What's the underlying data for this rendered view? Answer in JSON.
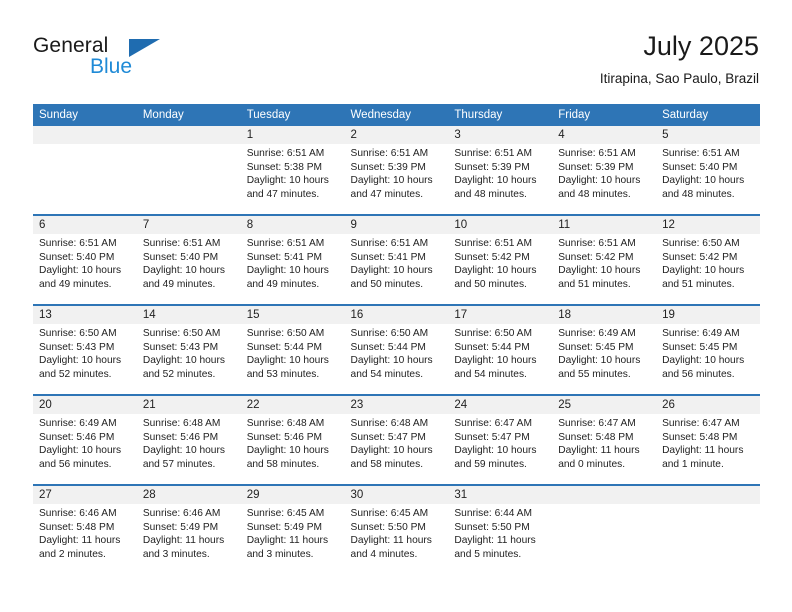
{
  "logo": {
    "word_one": "General",
    "word_two": "Blue",
    "triangle_icon": "triangle-icon",
    "accent_dark": "#1f6cb0",
    "accent_light": "#1f8ad6"
  },
  "header": {
    "title": "July 2025",
    "subtitle": "Itirapina, Sao Paulo, Brazil",
    "header_bg": "#2e75b6",
    "daynum_bg": "#f1f1f1"
  },
  "weekdays": [
    "Sunday",
    "Monday",
    "Tuesday",
    "Wednesday",
    "Thursday",
    "Friday",
    "Saturday"
  ],
  "weeks": [
    [
      {
        "day": "",
        "lines": []
      },
      {
        "day": "",
        "lines": []
      },
      {
        "day": "1",
        "lines": [
          "Sunrise: 6:51 AM",
          "Sunset: 5:38 PM",
          "Daylight: 10 hours",
          "and 47 minutes."
        ]
      },
      {
        "day": "2",
        "lines": [
          "Sunrise: 6:51 AM",
          "Sunset: 5:39 PM",
          "Daylight: 10 hours",
          "and 47 minutes."
        ]
      },
      {
        "day": "3",
        "lines": [
          "Sunrise: 6:51 AM",
          "Sunset: 5:39 PM",
          "Daylight: 10 hours",
          "and 48 minutes."
        ]
      },
      {
        "day": "4",
        "lines": [
          "Sunrise: 6:51 AM",
          "Sunset: 5:39 PM",
          "Daylight: 10 hours",
          "and 48 minutes."
        ]
      },
      {
        "day": "5",
        "lines": [
          "Sunrise: 6:51 AM",
          "Sunset: 5:40 PM",
          "Daylight: 10 hours",
          "and 48 minutes."
        ]
      }
    ],
    [
      {
        "day": "6",
        "lines": [
          "Sunrise: 6:51 AM",
          "Sunset: 5:40 PM",
          "Daylight: 10 hours",
          "and 49 minutes."
        ]
      },
      {
        "day": "7",
        "lines": [
          "Sunrise: 6:51 AM",
          "Sunset: 5:40 PM",
          "Daylight: 10 hours",
          "and 49 minutes."
        ]
      },
      {
        "day": "8",
        "lines": [
          "Sunrise: 6:51 AM",
          "Sunset: 5:41 PM",
          "Daylight: 10 hours",
          "and 49 minutes."
        ]
      },
      {
        "day": "9",
        "lines": [
          "Sunrise: 6:51 AM",
          "Sunset: 5:41 PM",
          "Daylight: 10 hours",
          "and 50 minutes."
        ]
      },
      {
        "day": "10",
        "lines": [
          "Sunrise: 6:51 AM",
          "Sunset: 5:42 PM",
          "Daylight: 10 hours",
          "and 50 minutes."
        ]
      },
      {
        "day": "11",
        "lines": [
          "Sunrise: 6:51 AM",
          "Sunset: 5:42 PM",
          "Daylight: 10 hours",
          "and 51 minutes."
        ]
      },
      {
        "day": "12",
        "lines": [
          "Sunrise: 6:50 AM",
          "Sunset: 5:42 PM",
          "Daylight: 10 hours",
          "and 51 minutes."
        ]
      }
    ],
    [
      {
        "day": "13",
        "lines": [
          "Sunrise: 6:50 AM",
          "Sunset: 5:43 PM",
          "Daylight: 10 hours",
          "and 52 minutes."
        ]
      },
      {
        "day": "14",
        "lines": [
          "Sunrise: 6:50 AM",
          "Sunset: 5:43 PM",
          "Daylight: 10 hours",
          "and 52 minutes."
        ]
      },
      {
        "day": "15",
        "lines": [
          "Sunrise: 6:50 AM",
          "Sunset: 5:44 PM",
          "Daylight: 10 hours",
          "and 53 minutes."
        ]
      },
      {
        "day": "16",
        "lines": [
          "Sunrise: 6:50 AM",
          "Sunset: 5:44 PM",
          "Daylight: 10 hours",
          "and 54 minutes."
        ]
      },
      {
        "day": "17",
        "lines": [
          "Sunrise: 6:50 AM",
          "Sunset: 5:44 PM",
          "Daylight: 10 hours",
          "and 54 minutes."
        ]
      },
      {
        "day": "18",
        "lines": [
          "Sunrise: 6:49 AM",
          "Sunset: 5:45 PM",
          "Daylight: 10 hours",
          "and 55 minutes."
        ]
      },
      {
        "day": "19",
        "lines": [
          "Sunrise: 6:49 AM",
          "Sunset: 5:45 PM",
          "Daylight: 10 hours",
          "and 56 minutes."
        ]
      }
    ],
    [
      {
        "day": "20",
        "lines": [
          "Sunrise: 6:49 AM",
          "Sunset: 5:46 PM",
          "Daylight: 10 hours",
          "and 56 minutes."
        ]
      },
      {
        "day": "21",
        "lines": [
          "Sunrise: 6:48 AM",
          "Sunset: 5:46 PM",
          "Daylight: 10 hours",
          "and 57 minutes."
        ]
      },
      {
        "day": "22",
        "lines": [
          "Sunrise: 6:48 AM",
          "Sunset: 5:46 PM",
          "Daylight: 10 hours",
          "and 58 minutes."
        ]
      },
      {
        "day": "23",
        "lines": [
          "Sunrise: 6:48 AM",
          "Sunset: 5:47 PM",
          "Daylight: 10 hours",
          "and 58 minutes."
        ]
      },
      {
        "day": "24",
        "lines": [
          "Sunrise: 6:47 AM",
          "Sunset: 5:47 PM",
          "Daylight: 10 hours",
          "and 59 minutes."
        ]
      },
      {
        "day": "25",
        "lines": [
          "Sunrise: 6:47 AM",
          "Sunset: 5:48 PM",
          "Daylight: 11 hours",
          "and 0 minutes."
        ]
      },
      {
        "day": "26",
        "lines": [
          "Sunrise: 6:47 AM",
          "Sunset: 5:48 PM",
          "Daylight: 11 hours",
          "and 1 minute."
        ]
      }
    ],
    [
      {
        "day": "27",
        "lines": [
          "Sunrise: 6:46 AM",
          "Sunset: 5:48 PM",
          "Daylight: 11 hours",
          "and 2 minutes."
        ]
      },
      {
        "day": "28",
        "lines": [
          "Sunrise: 6:46 AM",
          "Sunset: 5:49 PM",
          "Daylight: 11 hours",
          "and 3 minutes."
        ]
      },
      {
        "day": "29",
        "lines": [
          "Sunrise: 6:45 AM",
          "Sunset: 5:49 PM",
          "Daylight: 11 hours",
          "and 3 minutes."
        ]
      },
      {
        "day": "30",
        "lines": [
          "Sunrise: 6:45 AM",
          "Sunset: 5:50 PM",
          "Daylight: 11 hours",
          "and 4 minutes."
        ]
      },
      {
        "day": "31",
        "lines": [
          "Sunrise: 6:44 AM",
          "Sunset: 5:50 PM",
          "Daylight: 11 hours",
          "and 5 minutes."
        ]
      },
      {
        "day": "",
        "lines": []
      },
      {
        "day": "",
        "lines": []
      }
    ]
  ]
}
